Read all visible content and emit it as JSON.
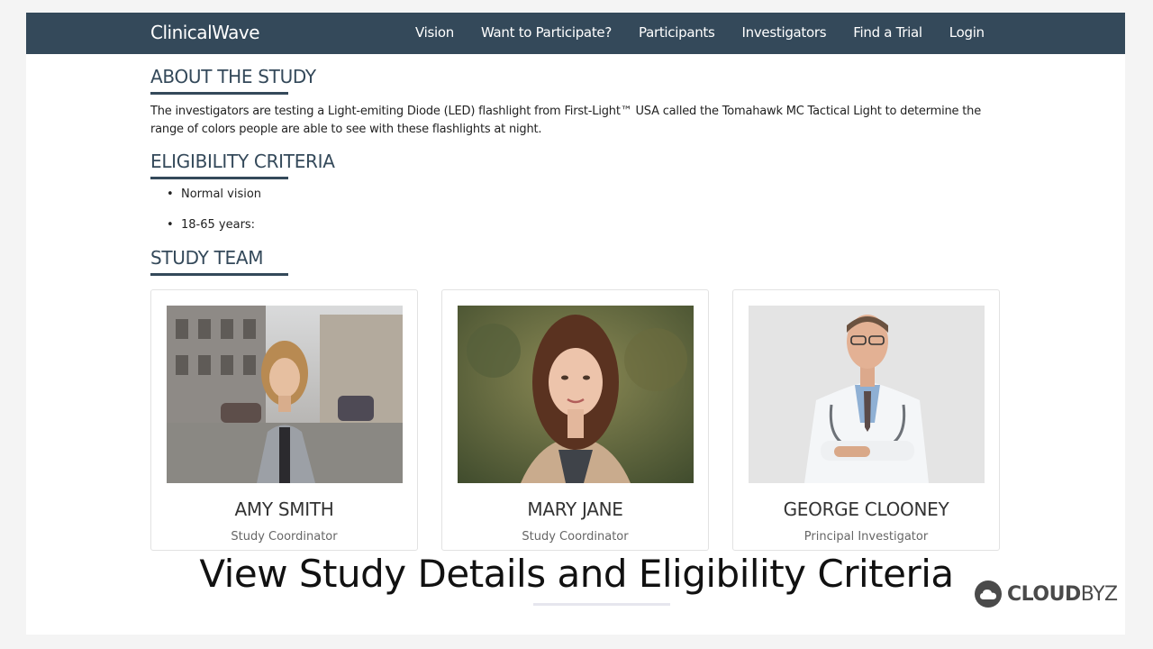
{
  "nav": {
    "brand": "ClinicalWave",
    "links": [
      "Vision",
      "Want to Participate?",
      "Participants",
      "Investigators",
      "Find a Trial",
      "Login"
    ]
  },
  "about": {
    "title": "ABOUT THE STUDY",
    "text": "The investigators are testing a Light-emiting Diode (LED) flashlight from First-Light™ USA called the Tomahawk MC Tactical Light to determine the range of colors people are able to see with these flashlights at night."
  },
  "eligibility": {
    "title": "ELIGIBILITY CRITERIA",
    "items": [
      "Normal vision",
      "18-65 years:"
    ]
  },
  "team": {
    "title": "STUDY TEAM",
    "members": [
      {
        "name": "AMY SMITH",
        "role": "Study Coordinator"
      },
      {
        "name": "MARY JANE",
        "role": "Study Coordinator"
      },
      {
        "name": "GEORGE CLOONEY",
        "role": "Principal Investigator"
      }
    ]
  },
  "caption": "View Study Details and Eligibility Criteria",
  "logo": {
    "bold": "CLOUD",
    "light": "BYZ"
  }
}
